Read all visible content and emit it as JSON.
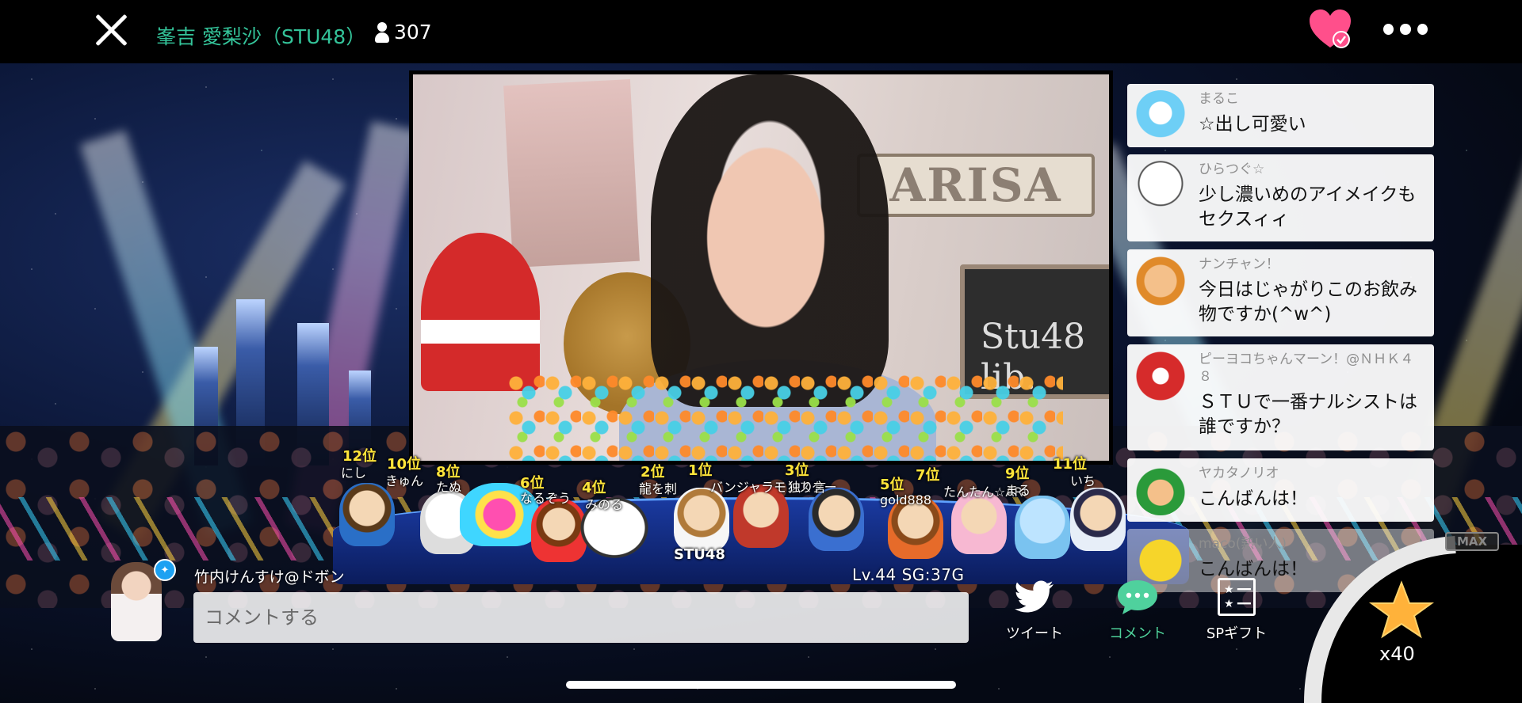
{
  "header": {
    "room_title": "峯吉 愛梨沙（STU48）",
    "viewer_count": "307"
  },
  "video": {
    "sign_text": "ARISA",
    "board_text": "Stu48 lib."
  },
  "ranking": [
    {
      "rank": "12位",
      "name": "にし"
    },
    {
      "rank": "10位",
      "name": "きゅん"
    },
    {
      "rank": "8位",
      "name": "たぬ"
    },
    {
      "rank": "6位",
      "name": "なるぞう"
    },
    {
      "rank": "4位",
      "name": "みのる"
    },
    {
      "rank": "2位",
      "name": "龍を刺"
    },
    {
      "rank": "1位",
      "name": "バンジャラモンスター"
    },
    {
      "rank": "3位",
      "name": "独り言"
    },
    {
      "rank": "5位",
      "name": "gold888"
    },
    {
      "rank": "7位",
      "name": "たんたん☆ARI"
    },
    {
      "rank": "9位",
      "name": "まる"
    },
    {
      "rank": "11位",
      "name": "いち"
    }
  ],
  "ranking_extra": {
    "stage_label": "STU48"
  },
  "comments": [
    {
      "name": "まるこ",
      "text": "☆出し可愛い"
    },
    {
      "name": "ひらつぐ☆",
      "text": "少し濃いめのアイメイクもセクスィィ"
    },
    {
      "name": "ナンチャン！",
      "text": "今日はじゃがりこのお飲み物ですか(^w^)"
    },
    {
      "name": "ピーヨコちゃんマーン！@ＮＨＫ４８",
      "text": "ＳＴＵで一番ナルシストは誰ですか？"
    },
    {
      "name": "ヤカタノリオ",
      "text": "こんばんは！"
    },
    {
      "name": "maco(熱い人)",
      "text": "こんばんは！"
    }
  ],
  "bottom": {
    "username": "竹内けんすけ@ドボン",
    "level": "Lv.44  SG:37G",
    "comment_placeholder": "コメントする",
    "tweet_label": "ツイート",
    "comment_label": "コメント",
    "sp_gift_label": "SPギフト",
    "gift_count": "x40",
    "max_label": "MAX"
  },
  "colors": {
    "title_green": "#34c49a",
    "heart_pink": "#ff4f8b",
    "active_green": "#4fd19d",
    "rank_yellow": "#ffe53a"
  },
  "icons": {
    "close": "close-icon",
    "viewer": "person-icon",
    "favorite": "heart-check-icon",
    "more": "more-dots-icon",
    "tweet": "twitter-bird-icon",
    "comment": "speech-bubble-icon",
    "sp_gift": "gift-list-icon",
    "gift_star": "star-icon"
  }
}
